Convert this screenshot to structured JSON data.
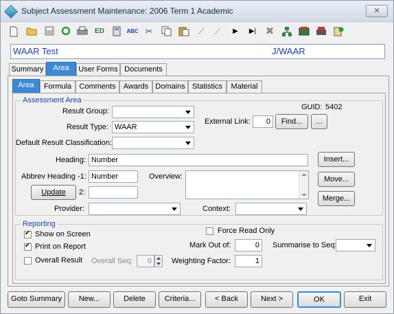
{
  "window": {
    "title": "Subject Assessment Maintenance:  2006 Term 1 Academic",
    "close": "✕"
  },
  "toolbar_icons": [
    "new-icon",
    "open-icon",
    "save-icon",
    "refresh-icon",
    "print-icon",
    "edit-icon",
    "calculator-icon",
    "spellcheck-icon",
    "cut-icon",
    "copy-icon",
    "paste-icon",
    "first-icon",
    "prev-icon",
    "next-icon",
    "last-icon",
    "delete-icon",
    "tree-icon",
    "folder-icon",
    "clip-icon"
  ],
  "namebar": {
    "left": "WAAR Test",
    "right": "J/WAAR"
  },
  "tabs_outer": [
    "Summary",
    "Area",
    "User Forms",
    "Documents"
  ],
  "tabs_inner": [
    "Area",
    "Formula",
    "Comments",
    "Awards",
    "Domains",
    "Statistics",
    "Material"
  ],
  "assessment_area": {
    "group_label": "Assessment Area",
    "guid_label": "GUID:",
    "guid_value": "5402",
    "result_group_label": "Result Group:",
    "result_group_value": "",
    "result_type_label": "Result Type:",
    "result_type_value": "WAAR",
    "default_result_class_label": "Default Result Classification:",
    "default_result_class_value": "",
    "external_link_label": "External Link:",
    "external_link_value": "0",
    "find_button": "Find...",
    "ellipsis_button": "...",
    "heading_label": "Heading:",
    "heading_value": "Number",
    "insert_button": "Insert...",
    "abbrev_label": "Abbrev Heading -1:",
    "abbrev_value": "Number",
    "overview_label": "Overview:",
    "overview_value": "",
    "move_button": "Move...",
    "update_button": "Update",
    "abbrev2_label": "2:",
    "abbrev2_value": "",
    "merge_button": "Merge...",
    "provider_label": "Provider:",
    "provider_value": "",
    "context_label": "Context:",
    "context_value": ""
  },
  "reporting": {
    "group_label": "Reporting",
    "show_on_screen": "Show on Screen",
    "print_on_report": "Print on Report",
    "overall_result": "Overall Result",
    "overall_seq_label": "Overall Seq:",
    "overall_seq_value": "0",
    "force_read_only": "Force Read Only",
    "mark_out_of_label": "Mark Out of:",
    "mark_out_of_value": "0",
    "summarise_label": "Summarise to Seq:",
    "summarise_value": "",
    "weighting_label": "Weighting Factor:",
    "weighting_value": "1",
    "show_on_screen_checked": true,
    "print_on_report_checked": true,
    "overall_result_checked": false,
    "force_read_only_checked": false
  },
  "buttons": {
    "goto_summary": "Goto Summary",
    "new": "New...",
    "delete": "Delete",
    "criteria": "Criteria...",
    "back": "< Back",
    "next": "Next >",
    "ok": "OK",
    "exit": "Exit"
  },
  "colors": {
    "accent": "#3c8ad6",
    "link_text": "#1a3fbf"
  }
}
